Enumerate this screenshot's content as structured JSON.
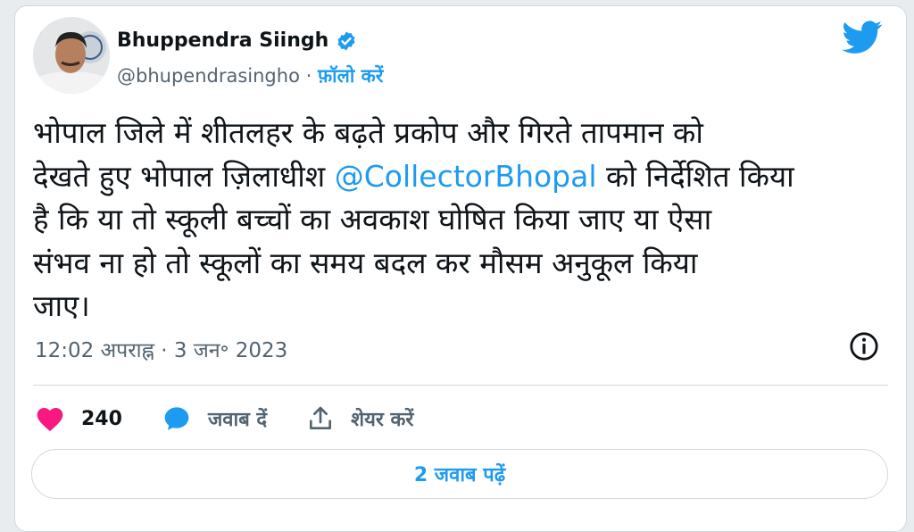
{
  "author": {
    "name": "Bhuppendra Siingh",
    "handle": "@bhupendrasingho",
    "separator": "·",
    "follow_label": "फ़ॉलो करें"
  },
  "tweet": {
    "line1": "भोपाल जिले में शीतलहर के बढ़ते प्रकोप और गिरते तापमान को",
    "line2_pre": "देखते हुए भोपाल ज़िलाधीश ",
    "mention": "@CollectorBhopal",
    "line2_post": " को निर्देशित किया",
    "line3": "है कि या तो स्कूली बच्चों का अवकाश घोषित किया जाए या ऐसा",
    "line4": "संभव ना हो तो स्कूलों का समय बदल कर मौसम अनुकूल किया",
    "line5": "जाए।"
  },
  "meta": {
    "timestamp": "12:02 अपराह्न · 3 जन॰ 2023"
  },
  "actions": {
    "likes": "240",
    "reply_label": "जवाब दें",
    "share_label": "शेयर करें"
  },
  "read_replies_label": "2 जवाब पढ़ें",
  "colors": {
    "accent": "#1d9bf0",
    "like": "#f91880",
    "text": "#0f1419",
    "muted": "#536471"
  },
  "icons": [
    "verified-badge-icon",
    "twitter-bird-icon",
    "info-icon",
    "heart-icon",
    "reply-bubble-icon",
    "share-icon"
  ]
}
